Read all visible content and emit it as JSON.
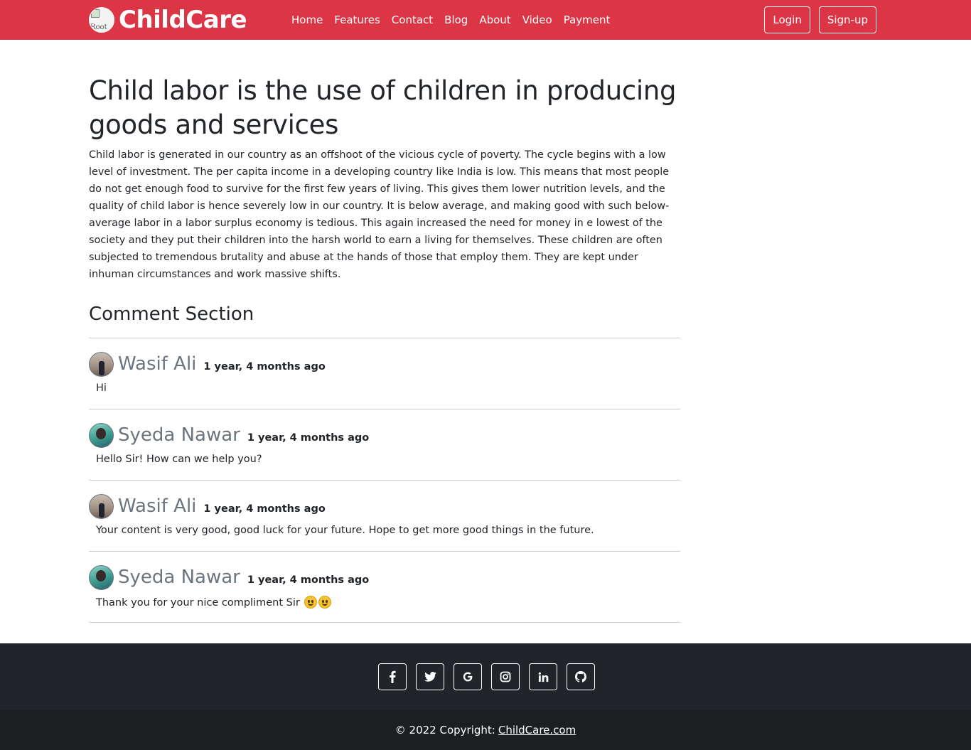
{
  "navbar": {
    "brand": "ChildCare",
    "logo_alt": "Root",
    "links": [
      "Home",
      "Features",
      "Contact",
      "Blog",
      "About",
      "Video",
      "Payment"
    ],
    "login": "Login",
    "signup": "Sign-up"
  },
  "post": {
    "title": "Child labor is the use of children in producing goods and services",
    "body": "Child labor is generated in our country as an offshoot of the vicious cycle of poverty. The cycle begins with a low level of investment. The per capita income in a developing country like India is low. This means that most people do not get enough food to survive for the first few years of living. This gives them lower nutrition levels, and the quality of child labor is hence severely low in our country. It is below average, and making good with such below-average labor in a labor surplus economy is tedious. This again increased the need for money in e lowest of the society and they put their children into the harsh world to earn a living for themselves. These children are often subjected to tremendous brutality and abuse at the hands of those that employ them. They are kept under inhuman circumstances and work massive shifts."
  },
  "comments_heading": "Comment Section",
  "comments": [
    {
      "name": "Wasif Ali",
      "time": "1 year, 4 months ago",
      "text": "Hi"
    },
    {
      "name": "Syeda Nawar",
      "time": "1 year, 4 months ago",
      "text": "Hello Sir! How can we help you?"
    },
    {
      "name": "Wasif Ali",
      "time": "1 year, 4 months ago",
      "text": "Your content is very good, good luck for your future. Hope to get more good things in the future."
    },
    {
      "name": "Syeda Nawar",
      "time": "1 year, 4 months ago",
      "text": "Thank you for your nice compliment Sir"
    }
  ],
  "social_icons": [
    "facebook-icon",
    "twitter-icon",
    "google-icon",
    "instagram-icon",
    "linkedin-icon",
    "github-icon"
  ],
  "footer": {
    "copyright": "© 2022 Copyright:",
    "link": "ChildCare.com"
  },
  "colors": {
    "navbar": "#dc3545",
    "footer_top": "#212529",
    "footer_bottom": "#1b1f22",
    "muted": "#6c757d"
  }
}
